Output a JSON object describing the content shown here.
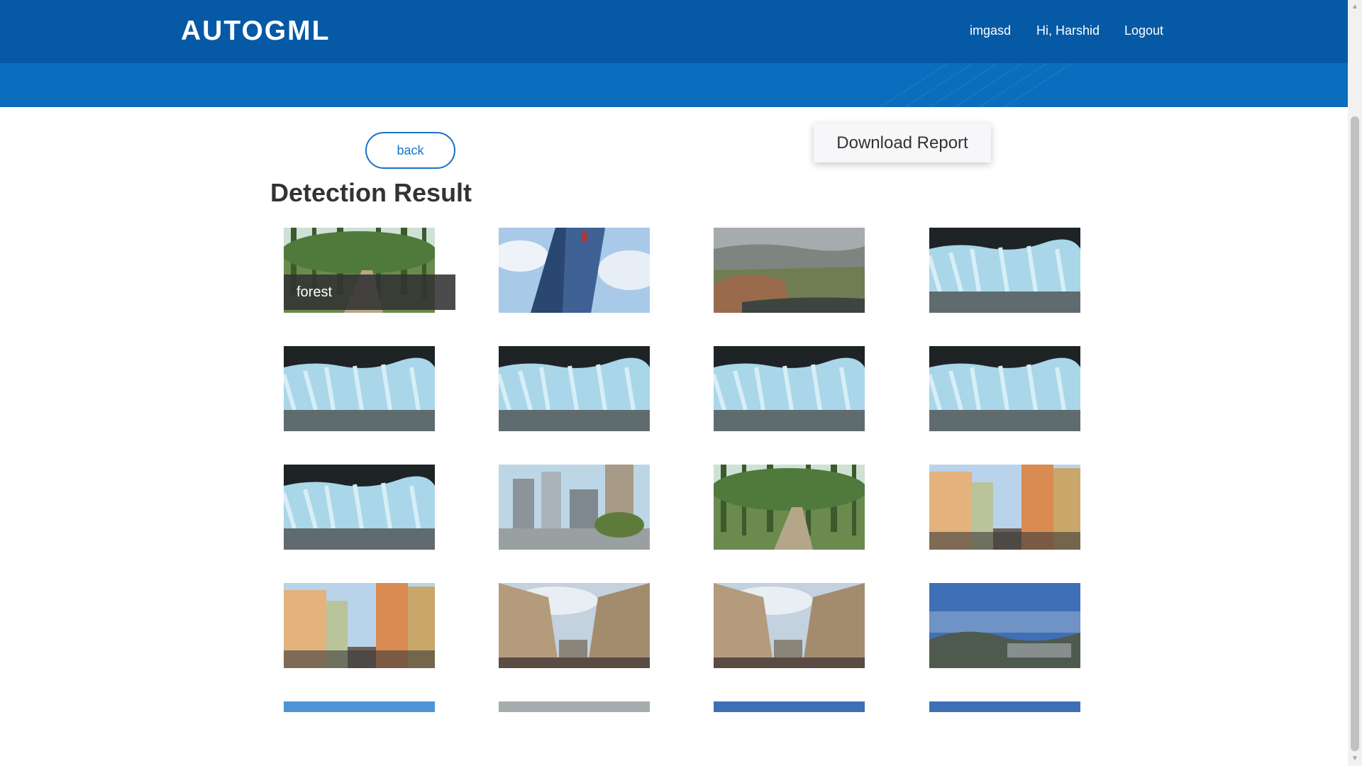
{
  "header": {
    "brand": "AUTOGML",
    "nav": [
      {
        "label": "imgasd"
      },
      {
        "label": "Hi, Harshid"
      },
      {
        "label": "Logout"
      }
    ]
  },
  "actions": {
    "back_label": "back",
    "download_label": "Download Report"
  },
  "page_title": "Detection Result",
  "hover_label": "forest",
  "gallery": [
    {
      "scene": "forest"
    },
    {
      "scene": "skyscraper"
    },
    {
      "scene": "mountain"
    },
    {
      "scene": "glacier"
    },
    {
      "scene": "glacier"
    },
    {
      "scene": "glacier"
    },
    {
      "scene": "glacier"
    },
    {
      "scene": "glacier"
    },
    {
      "scene": "glacier"
    },
    {
      "scene": "city"
    },
    {
      "scene": "forest"
    },
    {
      "scene": "street"
    },
    {
      "scene": "street"
    },
    {
      "scene": "buildings"
    },
    {
      "scene": "buildings"
    },
    {
      "scene": "sea"
    },
    {
      "scene": "sky"
    },
    {
      "scene": "mountain"
    },
    {
      "scene": "sea"
    },
    {
      "scene": "sea"
    }
  ],
  "colors": {
    "header": "#0559a5",
    "subheader": "#0b6dbd",
    "accent": "#1a72c6"
  }
}
